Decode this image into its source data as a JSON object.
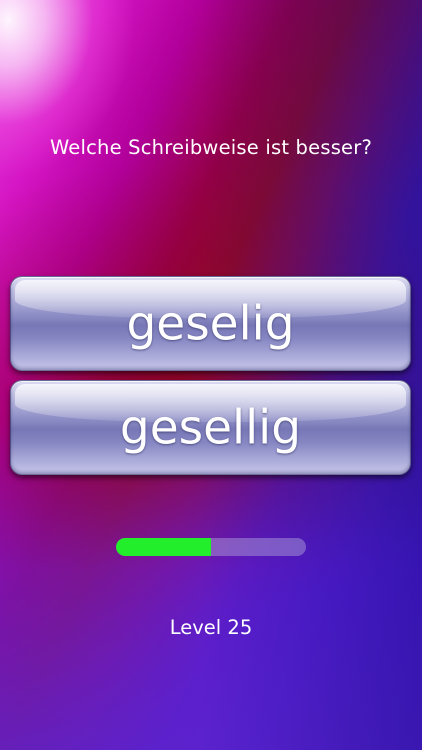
{
  "quiz": {
    "question": "Welche Schreibweise ist besser?",
    "answers": [
      {
        "label": "geselig"
      },
      {
        "label": "gesellig"
      }
    ]
  },
  "progress": {
    "fraction": 0.5,
    "fill_color": "#22ee2c"
  },
  "level": {
    "label": "Level 25"
  },
  "colors": {
    "background_top_left": "#e93ee0",
    "background_center": "#8a0a2a",
    "background_right": "#2d1ab0",
    "button_face": "#8f8fc7",
    "text": "#ffffff"
  }
}
